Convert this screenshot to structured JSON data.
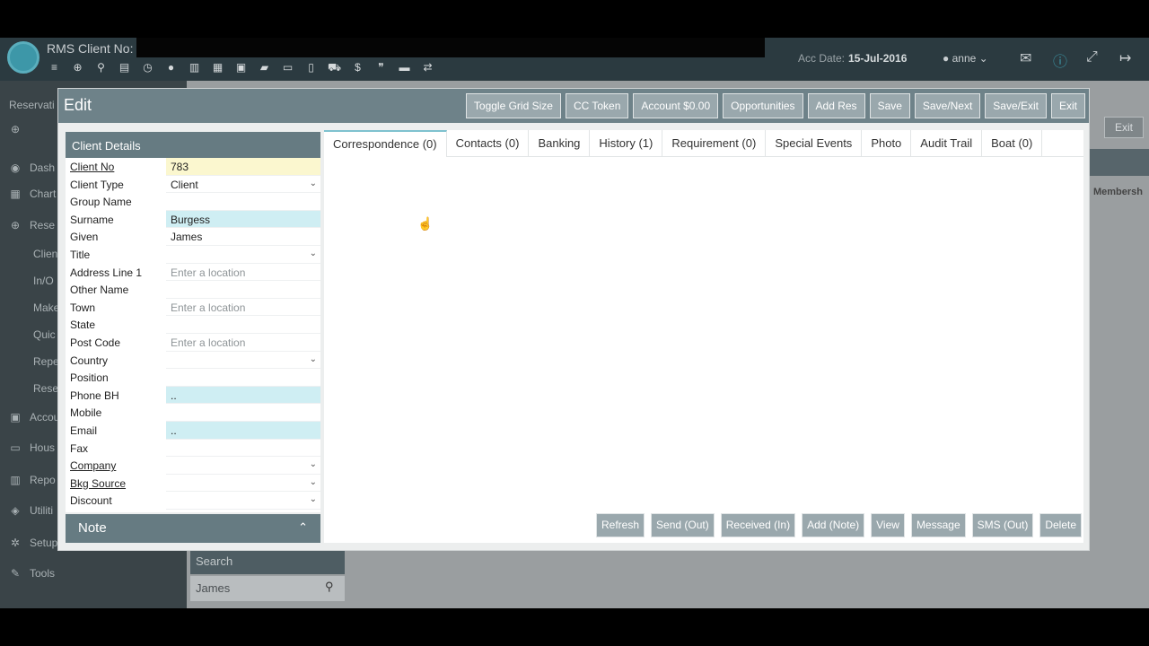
{
  "app": {
    "title": "RMS Client No: ",
    "acc_date_label": "Acc Date:",
    "acc_date_value": "15-Jul-2016",
    "user": "anne",
    "toolbar_icons": [
      "menu-icon",
      "plus-circle-icon",
      "search-icon",
      "card-icon",
      "dashboard-icon",
      "user-icon",
      "map-icon",
      "calendar-icon",
      "calendar-check-icon",
      "book-icon",
      "money-icon",
      "document-icon",
      "cart-icon",
      "dollar-icon",
      "quote-icon",
      "bed-icon",
      "transfer-icon"
    ]
  },
  "sidebar": {
    "items": [
      {
        "label": "Reservati",
        "icon": ""
      },
      {
        "label": "",
        "icon": "⊕"
      },
      {
        "label": "Dash",
        "icon": "◉"
      },
      {
        "label": "Chart",
        "icon": "▦"
      },
      {
        "label": "Rese",
        "icon": "⊕"
      },
      {
        "label": "Clien",
        "icon": ""
      },
      {
        "label": "In/O",
        "icon": ""
      },
      {
        "label": "Make",
        "icon": ""
      },
      {
        "label": "Quic",
        "icon": ""
      },
      {
        "label": "Repe",
        "icon": ""
      },
      {
        "label": "Rese",
        "icon": ""
      },
      {
        "label": "Accou",
        "icon": "▣"
      },
      {
        "label": "Hous",
        "icon": "▭"
      },
      {
        "label": "Repo",
        "icon": "▥"
      },
      {
        "label": "Utiliti",
        "icon": "◈"
      },
      {
        "label": "Setup",
        "icon": "✲"
      },
      {
        "label": "Tools",
        "icon": "✎"
      }
    ]
  },
  "background": {
    "exit_label": "Exit",
    "members_label": "Membersh",
    "search_label": "Search",
    "search_value": "James"
  },
  "modal": {
    "title": "Edit",
    "header_buttons": [
      "Toggle Grid Size",
      "CC Token",
      "Account $0.00",
      "Opportunities",
      "Add Res",
      "Save",
      "Save/Next",
      "Save/Exit",
      "Exit"
    ],
    "client_details_title": "Client Details",
    "fields": [
      {
        "label": "Client No",
        "value": "783",
        "style": "yellow",
        "underline": true,
        "dropdown": false
      },
      {
        "label": "Client Type",
        "value": "Client",
        "style": "",
        "underline": false,
        "dropdown": true
      },
      {
        "label": "Group Name",
        "value": "",
        "style": "",
        "underline": false,
        "dropdown": false
      },
      {
        "label": "Surname",
        "value": "Burgess",
        "style": "blue",
        "underline": false,
        "dropdown": false
      },
      {
        "label": "Given",
        "value": "James",
        "style": "",
        "underline": false,
        "dropdown": false
      },
      {
        "label": "Title",
        "value": "",
        "style": "",
        "underline": false,
        "dropdown": true
      },
      {
        "label": "Address Line 1",
        "value": "",
        "placeholder": "Enter a location",
        "style": "",
        "underline": false,
        "dropdown": false
      },
      {
        "label": "Other Name",
        "value": "",
        "style": "",
        "underline": false,
        "dropdown": false
      },
      {
        "label": "Town",
        "value": "",
        "placeholder": "Enter a location",
        "style": "",
        "underline": false,
        "dropdown": false
      },
      {
        "label": "State",
        "value": "",
        "style": "",
        "underline": false,
        "dropdown": false
      },
      {
        "label": "Post Code",
        "value": "",
        "placeholder": "Enter a location",
        "style": "",
        "underline": false,
        "dropdown": false
      },
      {
        "label": "Country",
        "value": "",
        "style": "",
        "underline": false,
        "dropdown": true
      },
      {
        "label": "Position",
        "value": "",
        "style": "",
        "underline": false,
        "dropdown": false
      },
      {
        "label": "Phone BH",
        "value": "..",
        "style": "blue",
        "underline": false,
        "dropdown": false
      },
      {
        "label": "Mobile",
        "value": "",
        "style": "",
        "underline": false,
        "dropdown": false
      },
      {
        "label": "Email",
        "value": "..",
        "style": "blue",
        "underline": false,
        "dropdown": false
      },
      {
        "label": "Fax",
        "value": "",
        "style": "",
        "underline": false,
        "dropdown": false
      },
      {
        "label": "Company",
        "value": "",
        "style": "",
        "underline": true,
        "dropdown": true
      },
      {
        "label": "Bkg Source",
        "value": "",
        "style": "",
        "underline": true,
        "dropdown": true
      },
      {
        "label": "Discount",
        "value": "",
        "style": "",
        "underline": false,
        "dropdown": true
      }
    ],
    "note_label": "Note",
    "tabs": [
      "Correspondence (0)",
      "Contacts (0)",
      "Banking",
      "History (1)",
      "Requirement (0)",
      "Special Events",
      "Photo",
      "Audit Trail",
      "Boat (0)"
    ],
    "active_tab": 0,
    "bottom_buttons": [
      "Refresh",
      "Send (Out)",
      "Received (In)",
      "Add (Note)",
      "View",
      "Message",
      "SMS (Out)",
      "Delete"
    ]
  }
}
